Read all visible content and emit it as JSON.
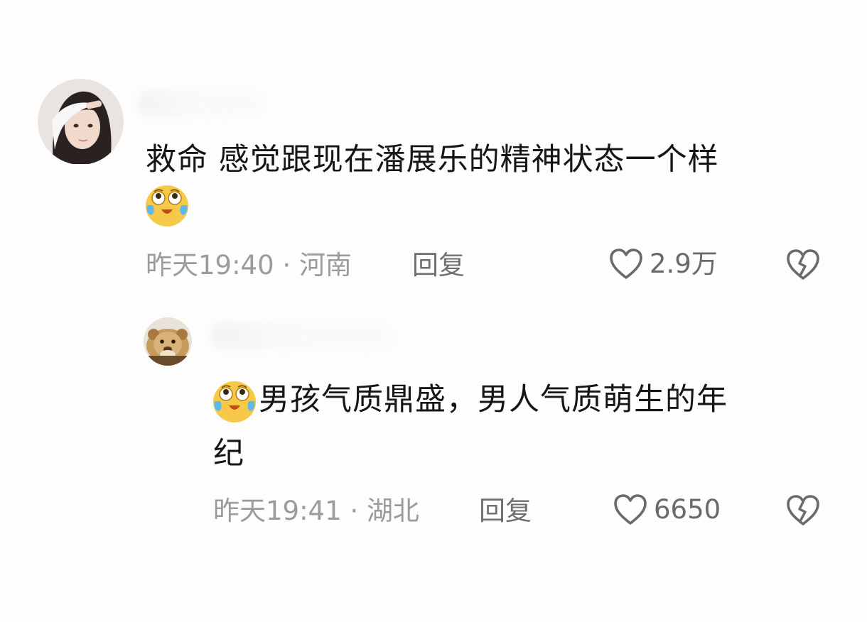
{
  "comments": [
    {
      "text_line1": "救命  感觉跟现在潘展乐的精神状态一个样",
      "emoji": "crying-face-emoji",
      "time": "昨天19:40",
      "separator": "·",
      "location": "河南",
      "reply_label": "回复",
      "likes": "2.9万",
      "avatar": "woman-avatar"
    },
    {
      "text_line1": "男孩气质鼎盛，男人气质萌生的年",
      "text_line2": "纪",
      "emoji": "crying-face-emoji",
      "time": "昨天19:41",
      "separator": "·",
      "location": "湖北",
      "reply_label": "回复",
      "likes": "6650",
      "avatar": "lion-cub-avatar"
    }
  ],
  "colors": {
    "text": "#161616",
    "meta": "#9b9b9b",
    "icon": "#6a6a6a",
    "emoji_yellow": "#f7c948"
  },
  "icons": [
    "heart-icon",
    "broken-heart-icon"
  ]
}
